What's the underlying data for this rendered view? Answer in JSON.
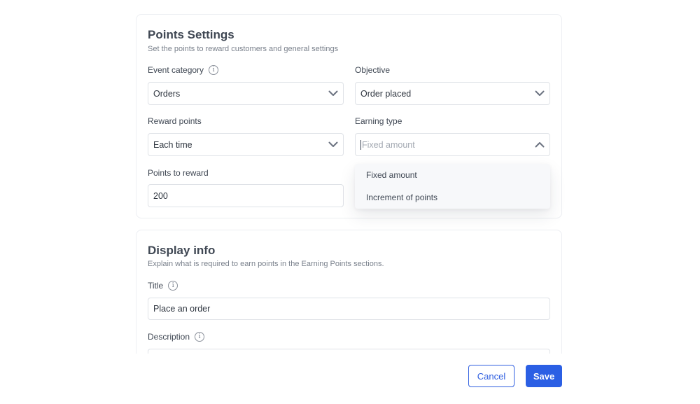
{
  "points_settings": {
    "title": "Points Settings",
    "subtitle": "Set the points to reward customers and general settings",
    "event_category": {
      "label": "Event category",
      "value": "Orders"
    },
    "objective": {
      "label": "Objective",
      "value": "Order placed"
    },
    "reward_points": {
      "label": "Reward points",
      "value": "Each time"
    },
    "earning_type": {
      "label": "Earning type",
      "placeholder": "Fixed amount",
      "options": [
        "Fixed amount",
        "Increment of points"
      ]
    },
    "points_to_reward": {
      "label": "Points to reward",
      "value": "200"
    }
  },
  "display_info": {
    "title": "Display info",
    "subtitle": "Explain what is required to earn points in the Earning Points sections.",
    "title_field": {
      "label": "Title",
      "value": "Place an order"
    },
    "description_field": {
      "label": "Description",
      "value": ""
    }
  },
  "footer": {
    "cancel_label": "Cancel",
    "save_label": "Save"
  },
  "icons": {
    "info": "info-icon",
    "chevron_down": "chevron-down-icon",
    "chevron_up": "chevron-up-icon"
  },
  "colors": {
    "primary": "#2b5fe4",
    "border": "#dfe2e7",
    "dropdown_bg": "#f7f8fa"
  }
}
